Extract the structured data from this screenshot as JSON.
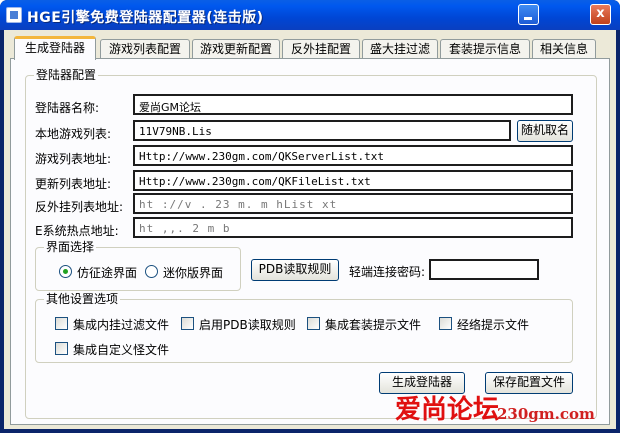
{
  "window": {
    "title": "HGE引擎免费登陆器配置器(连击版)",
    "minimize_label": "",
    "close_label": "x"
  },
  "tabs": [
    {
      "label": "生成登陆器",
      "active": true
    },
    {
      "label": "游戏列表配置",
      "active": false
    },
    {
      "label": "游戏更新配置",
      "active": false
    },
    {
      "label": "反外挂配置",
      "active": false
    },
    {
      "label": "盛大挂过滤",
      "active": false
    },
    {
      "label": "套装提示信息",
      "active": false
    },
    {
      "label": "相关信息",
      "active": false
    }
  ],
  "config": {
    "group_title": "登陆器配置",
    "login_name": {
      "label": "登陆器名称:",
      "value": "爱尚GM论坛"
    },
    "local_list": {
      "label": "本地游戏列表:",
      "value": "11V79NB.Lis"
    },
    "random_button": "随机取名",
    "list_url": {
      "label": "游戏列表地址:",
      "value": "Http://www.230gm.com/QKServerList.txt"
    },
    "update_url": {
      "label": "更新列表地址:",
      "value": "Http://www.230gm.com/QKFileList.txt"
    },
    "anticheat_url": {
      "label": "反外挂列表地址:",
      "value": "ht  ://v  . 23   m.    m       hList   xt"
    },
    "hotspot_url": {
      "label": "E系统热点地址:",
      "value": "ht   ,,.    2     m      b   "
    }
  },
  "ui_select": {
    "group_title": "界面选择",
    "option1": "仿征途界面",
    "option2": "迷你版界面",
    "selected": "仿征途界面"
  },
  "pdb_button": "PDB读取规则",
  "terminal_password": {
    "label": "轻端连接密码:",
    "value": ""
  },
  "other": {
    "group_title": "其他设置选项",
    "checks": [
      {
        "label": "集成内挂过滤文件",
        "checked": false
      },
      {
        "label": "启用PDB读取规则",
        "checked": false
      },
      {
        "label": "集成套装提示文件",
        "checked": false
      },
      {
        "label": "经络提示文件",
        "checked": false
      },
      {
        "label": "集成自定义怪文件",
        "checked": false
      }
    ]
  },
  "actions": {
    "generate": "生成登陆器",
    "save": "保存配置文件"
  },
  "watermark": {
    "text1": "爱尚论坛",
    "text2": "230gm.com"
  },
  "colors": {
    "titlebar": "#0058ee",
    "active_tab_accent": "#f3b63c",
    "watermark_red": "#e01010"
  }
}
